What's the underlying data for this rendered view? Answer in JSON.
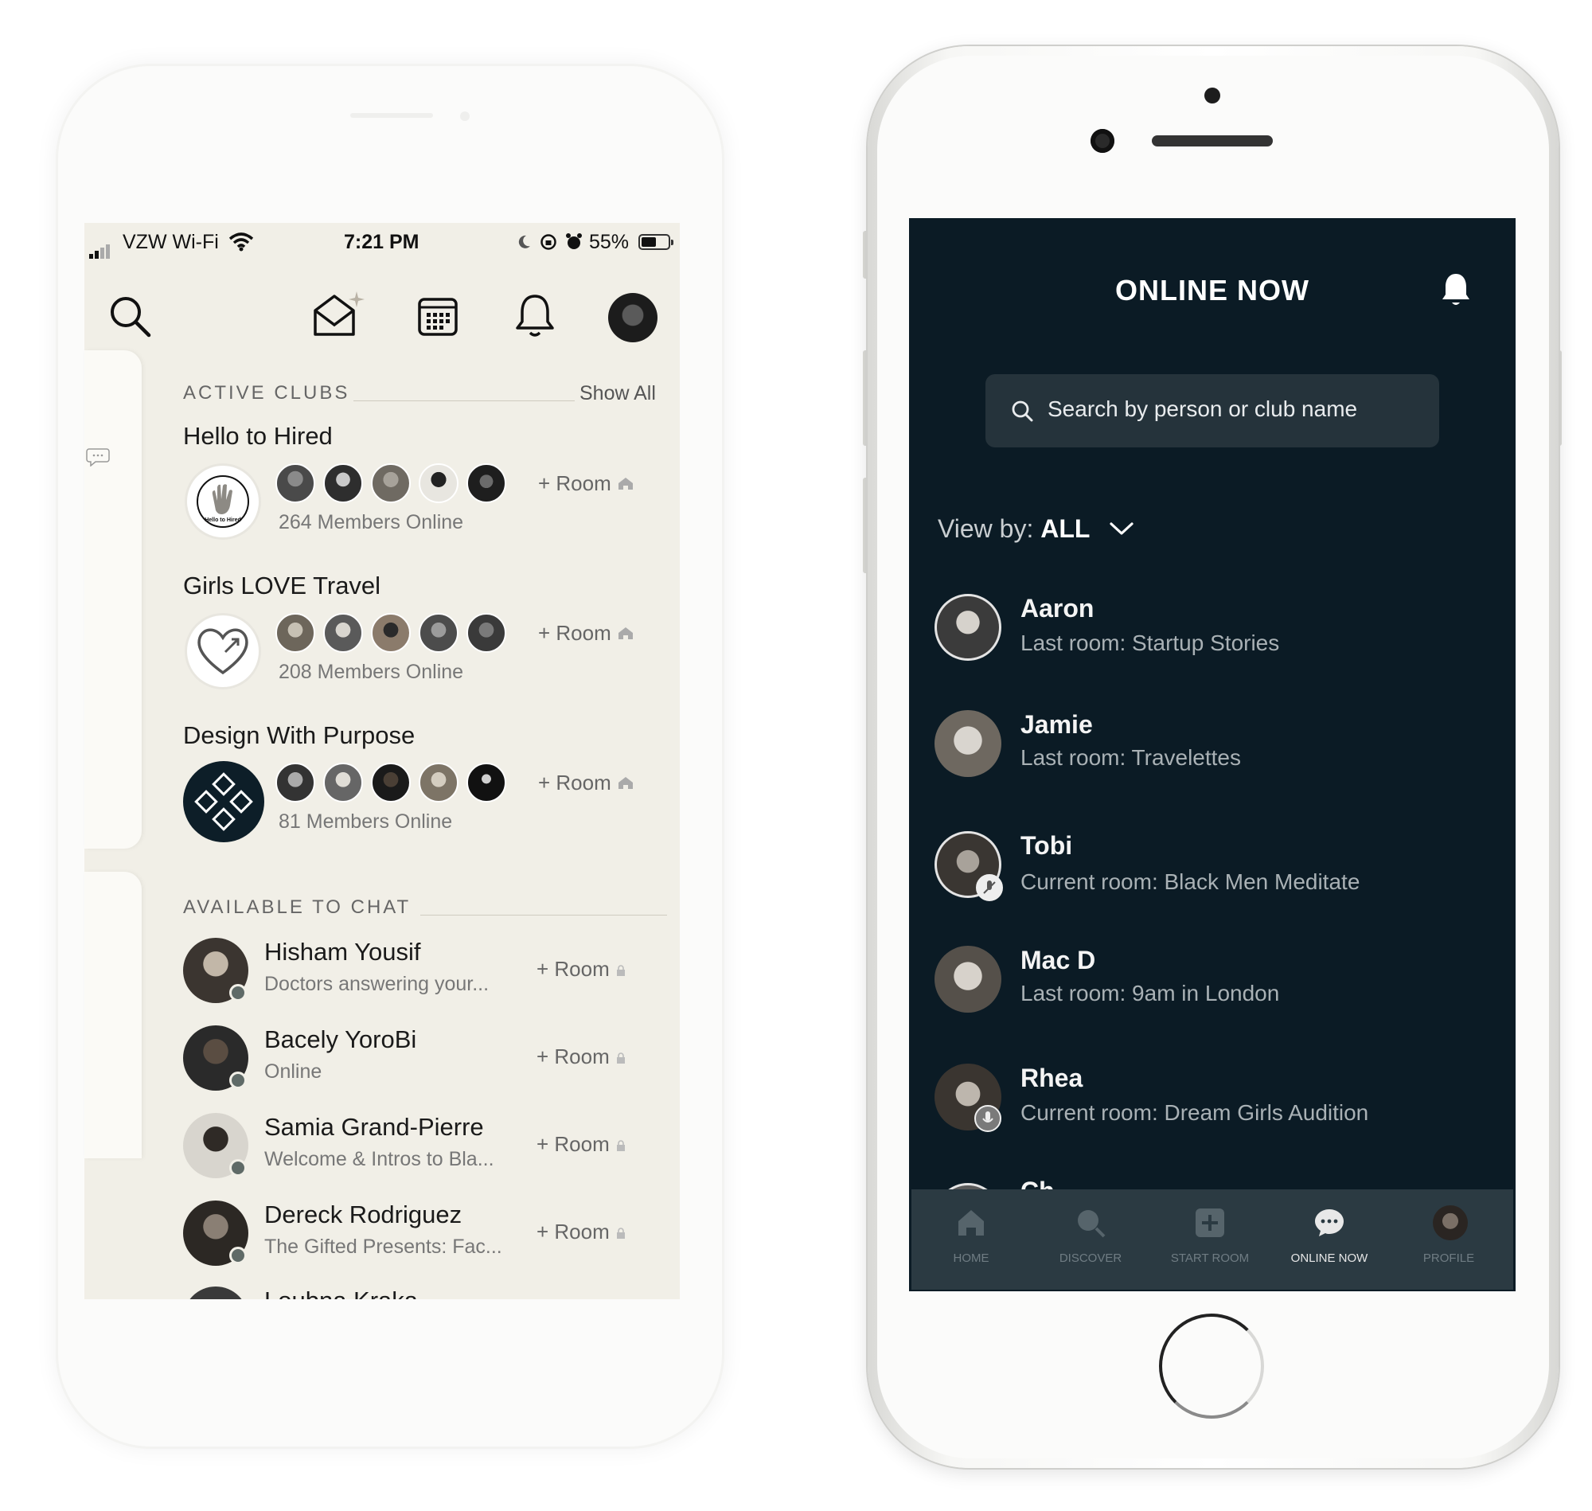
{
  "left_phone": {
    "status_bar": {
      "carrier": "VZW Wi-Fi",
      "time": "7:21 PM",
      "battery": "55%",
      "battery_level": 0.55
    },
    "active_clubs": {
      "title": "ACTIVE CLUBS",
      "show_all": "Show All",
      "clubs": [
        {
          "name": "Hello to Hired",
          "members_online": "264 Members Online",
          "room_label": "+ Room",
          "logo_text": "Hello to Hired"
        },
        {
          "name": "Girls LOVE Travel",
          "members_online": "208 Members Online",
          "room_label": "+ Room"
        },
        {
          "name": "Design With Purpose",
          "members_online": "81 Members Online",
          "room_label": "+ Room"
        }
      ]
    },
    "available_to_chat": {
      "title": "AVAILABLE TO CHAT",
      "people": [
        {
          "name": "Hisham Yousif",
          "status": "Doctors answering your...",
          "room_label": "+ Room"
        },
        {
          "name": "Bacely YoroBi",
          "status": "Online",
          "room_label": "+ Room"
        },
        {
          "name": "Samia Grand-Pierre",
          "status": "Welcome & Intros to Bla...",
          "room_label": "+ Room"
        },
        {
          "name": "Dereck Rodriguez",
          "status": "The Gifted Presents: Fac...",
          "room_label": "+ Room"
        },
        {
          "name": "Loubna Kraka",
          "status": "",
          "room_label": ""
        }
      ]
    }
  },
  "right_phone": {
    "header": {
      "title": "ONLINE NOW"
    },
    "search": {
      "placeholder": "Search by person or club name"
    },
    "view_by": {
      "label": "View by:",
      "value": "ALL"
    },
    "people": [
      {
        "name": "Aaron",
        "room": "Last room: Startup Stories",
        "mic": false
      },
      {
        "name": "Jamie",
        "room": "Last room: Travelettes",
        "mic": false
      },
      {
        "name": "Tobi",
        "room": "Current room: Black Men Meditate",
        "mic": true
      },
      {
        "name": "Mac D",
        "room": "Last room: 9am in London",
        "mic": false
      },
      {
        "name": "Rhea",
        "room": "Current room: Dream Girls Audition",
        "mic": true
      },
      {
        "name": "Ch",
        "room": "",
        "mic": false
      }
    ],
    "tabs": [
      {
        "label": "HOME",
        "icon": "home-icon",
        "active": false
      },
      {
        "label": "DISCOVER",
        "icon": "discover-icon",
        "active": false
      },
      {
        "label": "START ROOM",
        "icon": "start-room-icon",
        "active": false
      },
      {
        "label": "ONLINE NOW",
        "icon": "chat-bubble-icon",
        "active": true
      },
      {
        "label": "PROFILE",
        "icon": "profile-avatar-icon",
        "active": false
      }
    ]
  },
  "colors": {
    "left_bg": "#f1efe7",
    "right_bg": "#0b1b25",
    "search_bg": "#25333b",
    "tabbar_bg": "#2b3a42"
  }
}
